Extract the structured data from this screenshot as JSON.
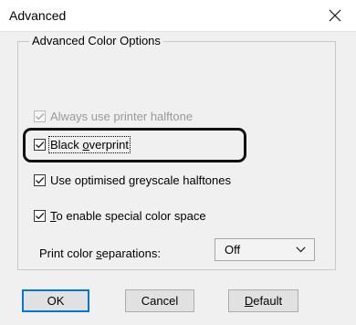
{
  "window": {
    "title": "Advanced",
    "close_icon": "close-icon"
  },
  "group": {
    "title": "Advanced Color Options"
  },
  "options": [
    {
      "label": "Always use printer halftone",
      "checked": true,
      "disabled": true
    },
    {
      "label_before": "Black ",
      "label_ul": "o",
      "label_after": "verprint",
      "checked": true,
      "disabled": false,
      "focused": true
    },
    {
      "label_before": "Use optimised ",
      "label_ul": "g",
      "label_after": "reyscale halftones",
      "checked": true,
      "disabled": false
    },
    {
      "label_before": "",
      "label_ul": "T",
      "label_after": "o enable special color space",
      "checked": true,
      "disabled": false
    }
  ],
  "separations": {
    "label_before": "Print color ",
    "label_ul": "s",
    "label_after": "eparations:",
    "value": "Off"
  },
  "buttons": {
    "ok": "OK",
    "cancel": "Cancel",
    "default_ul": "D",
    "default_rest": "efault"
  },
  "colors": {
    "accent": "#0078d7",
    "dialog_bg": "#f0f0f0",
    "highlight_ring": "#111111"
  }
}
